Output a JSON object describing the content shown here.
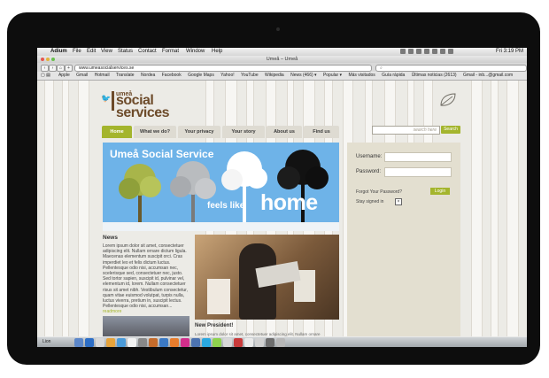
{
  "menubar": {
    "app": "Adium",
    "items": [
      "File",
      "Edit",
      "View",
      "Status",
      "Contact",
      "Format",
      "Window",
      "Help"
    ],
    "clock": "Fri 3:19 PM"
  },
  "browser": {
    "window_title": "Umeå – Umeå",
    "url": "www.umeasocialservices.se",
    "bookmarks": [
      "Apple",
      "Gmail",
      "Hotmail",
      "Translate",
      "Nordea",
      "Facebook",
      "Google Maps",
      "Yahoo!",
      "YouTube",
      "Wikipedia",
      "News (466) ▾",
      "Popular ▾",
      "Más visitados",
      "Guía rápida",
      "Últimas noticias (2613)",
      "Gmail - inb...@gmail.com"
    ]
  },
  "site": {
    "logo_small": "umeå",
    "logo_big_1": "social",
    "logo_big_2": "services",
    "nav": [
      "Home",
      "What we do?",
      "Your privacy",
      "Your story",
      "About us",
      "Find us"
    ],
    "search_placeholder": "search here",
    "search_button": "Search",
    "banner_title": "Umeå Social Service",
    "banner_tagline": "feels like",
    "banner_home": "home",
    "login": {
      "username_label": "Username:",
      "password_label": "Password:",
      "forgot": "Forgot Your Password?",
      "login_button": "Login",
      "stay": "Stay signed in"
    },
    "news": {
      "heading": "News",
      "body": "Lorem ipsum dolor sit amet, consectetuer adipiscing elit. Nullam ornare dictum ligula. Maecenas elementum suscipit orci. Cras imperdiet leo et felis dictum luctus. Pellentesque odio nisi, accumsan nec, scelerisque sed, consectetuer nec, justo. Sed tortor sapien, suscipit id, pulvinar vel, elementum id, lorem. Nullam consectetuer risus sit amet nibh. Vestibulum consectetur, quam vitae euismod volutpat, turpis nulla, luctus viverra, pretium in, suscipit lectus. Pellentesque odio nisi, accumsan...",
      "more": "readmore"
    },
    "newpres": "New President!",
    "newpres_body": "Lorem ipsum dolor sit amet, consectetuer adipiscing elit. Nullam ornare"
  },
  "dock": {
    "label": "Lion"
  }
}
